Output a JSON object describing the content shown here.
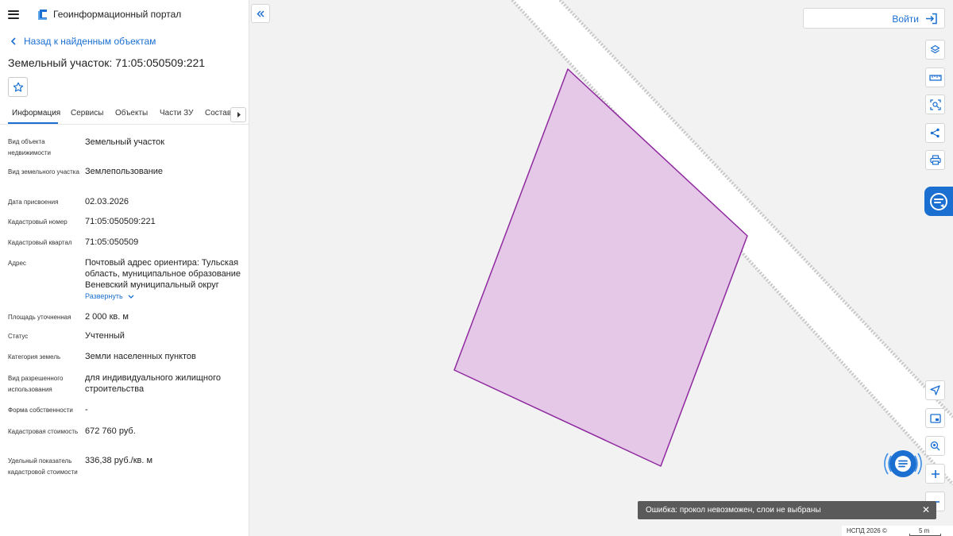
{
  "app": {
    "title": "Геоинформационный портал"
  },
  "nav": {
    "back_label": "Назад к найденным объектам"
  },
  "object": {
    "title": "Земельный участок: 71:05:050509:221"
  },
  "tabs": [
    {
      "label": "Информация"
    },
    {
      "label": "Сервисы"
    },
    {
      "label": "Объекты"
    },
    {
      "label": "Части ЗУ"
    },
    {
      "label": "Состав"
    }
  ],
  "info": {
    "rows": [
      {
        "label": "Вид объекта недвижимости",
        "value": "Земельный участок"
      },
      {
        "label": "Вид земельного участка",
        "value": "Землепользование"
      },
      {
        "label": "Дата присвоения",
        "value": "02.03.2026"
      },
      {
        "label": "Кадастровый номер",
        "value": "71:05:050509:221"
      },
      {
        "label": "Кадастровый квартал",
        "value": "71:05:050509"
      },
      {
        "label": "Адрес",
        "value": "Почтовый адрес ориентира: Тульская область, муниципальное образование Веневский муниципальный округ"
      },
      {
        "label": "Площадь уточненная",
        "value": "2 000 кв. м"
      },
      {
        "label": "Статус",
        "value": "Учтенный"
      },
      {
        "label": "Категория земель",
        "value": "Земли населенных пунктов"
      },
      {
        "label": "Вид разрешенного использования",
        "value": "для индивидуального жилищного строительства"
      },
      {
        "label": "Форма собственности",
        "value": "-"
      },
      {
        "label": "Кадастровая стоимость",
        "value": "672 760 руб."
      },
      {
        "label": "Удельный показатель кадастровой стоимости",
        "value": "336,38 руб./кв. м"
      }
    ],
    "expand_label": "Развернуть"
  },
  "header": {
    "login_label": "Войти"
  },
  "map": {
    "parcel_fill": "#e5c8e8",
    "parcel_stroke": "#8e2a9e",
    "road_color": "#ffffff",
    "background": "#f2f2f2"
  },
  "toolbar": {
    "top": [
      {
        "icon": "layers-icon"
      },
      {
        "icon": "ruler-icon"
      },
      {
        "icon": "select-area-icon"
      },
      {
        "icon": "share-icon"
      },
      {
        "icon": "print-icon"
      }
    ],
    "bottom": [
      {
        "icon": "locate-icon"
      },
      {
        "icon": "minimap-icon"
      },
      {
        "icon": "pin-icon"
      },
      {
        "icon": "zoom-in-icon"
      },
      {
        "icon": "zoom-out-icon"
      }
    ]
  },
  "notification": {
    "text": "Ошибка: прокол невозможен, слои не выбраны"
  },
  "footer": {
    "copyright": "НСПД 2026 ©",
    "scale_label": "5 m"
  },
  "colors": {
    "accent": "#1a6fd1",
    "toast_bg": "#5a5a5a"
  }
}
